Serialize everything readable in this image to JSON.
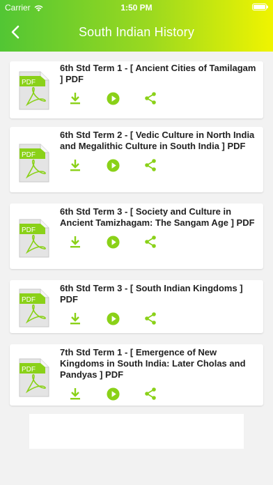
{
  "status": {
    "carrier": "Carrier",
    "time": "1:50 PM"
  },
  "navbar": {
    "title": "South Indian History",
    "back_icon": "chevron-left-icon"
  },
  "pdf_label": "PDF",
  "colors": {
    "accent": "#8ad118",
    "header_start": "#52c634",
    "header_end": "#f0f400"
  },
  "items": [
    {
      "title": "6th Std Term 1 - [ Ancient Cities of Tamilagam ] PDF"
    },
    {
      "title": "6th Std Term 2 - [ Vedic Culture in North India and Megalithic Culture in South India ] PDF"
    },
    {
      "title": "6th Std Term 3 - [ Society and Culture in Ancient Tamizhagam: The Sangam Age ] PDF"
    },
    {
      "title": "6th Std Term 3 - [ South Indian Kingdoms ] PDF"
    },
    {
      "title": "7th Std Term 1 - [ Emergence of New Kingdoms in South India: Later Cholas and Pandyas ] PDF"
    }
  ]
}
